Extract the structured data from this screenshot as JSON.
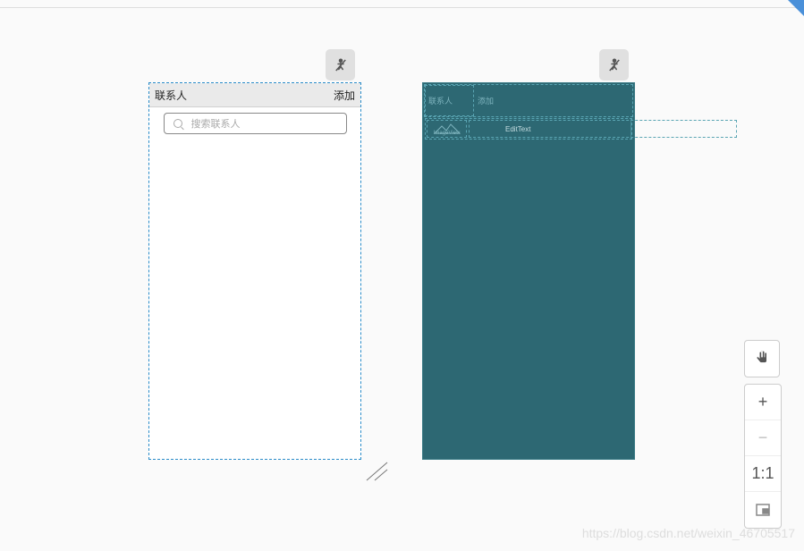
{
  "design": {
    "toolbar_title": "联系人",
    "toolbar_action": "添加",
    "search_placeholder": "搜索联系人"
  },
  "blueprint": {
    "toolbar_title_hint": "联系人",
    "toolbar_action_hint": "添加",
    "image_view_label": "ImageView",
    "edit_text_label": "EditText"
  },
  "zoom": {
    "pan_label": "Pan",
    "zoom_in": "+",
    "zoom_out": "−",
    "ratio": "1:1",
    "fit": "Fit"
  },
  "watermark": "https://blog.csdn.net/weixin_46705517"
}
